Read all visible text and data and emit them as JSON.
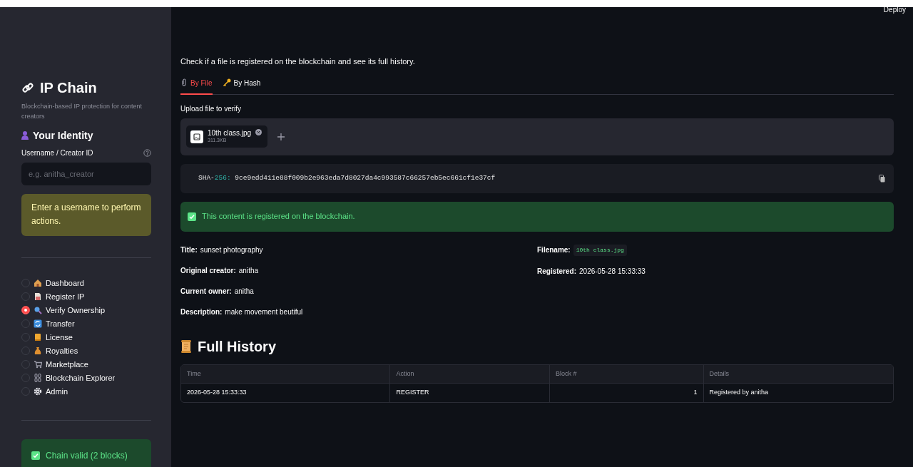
{
  "header": {
    "deploy": "Deploy"
  },
  "sidebar": {
    "title": "IP Chain",
    "subtitle": "Blockchain-based IP protection for content creators",
    "identity_heading": "Your Identity",
    "username_label": "Username / Creator ID",
    "username_placeholder": "e.g. anitha_creator",
    "warning": "Enter a username to perform actions.",
    "nav": [
      {
        "label": "Dashboard",
        "selected": false
      },
      {
        "label": "Register IP",
        "selected": false
      },
      {
        "label": "Verify Ownership",
        "selected": true
      },
      {
        "label": "Transfer",
        "selected": false
      },
      {
        "label": "License",
        "selected": false
      },
      {
        "label": "Royalties",
        "selected": false
      },
      {
        "label": "Marketplace",
        "selected": false
      },
      {
        "label": "Blockchain Explorer",
        "selected": false
      },
      {
        "label": "Admin",
        "selected": false
      }
    ],
    "chain_status": "Chain valid (2 blocks)"
  },
  "main": {
    "caption": "Check if a file is registered on the blockchain and see its full history.",
    "tabs": [
      {
        "label": "By File",
        "selected": true
      },
      {
        "label": "By Hash",
        "selected": false
      }
    ],
    "upload_label": "Upload file to verify",
    "file": {
      "name": "10th class.jpg",
      "size": "311.3KB"
    },
    "hash": {
      "prefix": "SHA-",
      "suffix": "256:",
      "value": "9ce9edd411e88f009b2e963eda7d8027da4c993587c66257eb5ec661cf1e37cf"
    },
    "success": "This content is registered on the blockchain.",
    "fields_left": [
      {
        "label": "Title:",
        "value": "sunset photography",
        "kind": "text"
      },
      {
        "label": "Original creator:",
        "value": "anitha",
        "kind": "text"
      },
      {
        "label": "Current owner:",
        "value": "anitha",
        "kind": "text"
      },
      {
        "label": "Description:",
        "value": "make movement beutiful",
        "kind": "text"
      }
    ],
    "fields_right": [
      {
        "label": "Filename:",
        "value": "10th class.jpg",
        "kind": "code"
      },
      {
        "label": "Registered:",
        "value": "2026-05-28 15:33:33",
        "kind": "text"
      }
    ],
    "history_heading": "Full History",
    "table": {
      "columns": [
        "Time",
        "Action",
        "Block #",
        "Details"
      ],
      "rows": [
        [
          "2026-05-28 15:33:33",
          "REGISTER",
          "1",
          "Registered by anitha"
        ]
      ]
    }
  }
}
